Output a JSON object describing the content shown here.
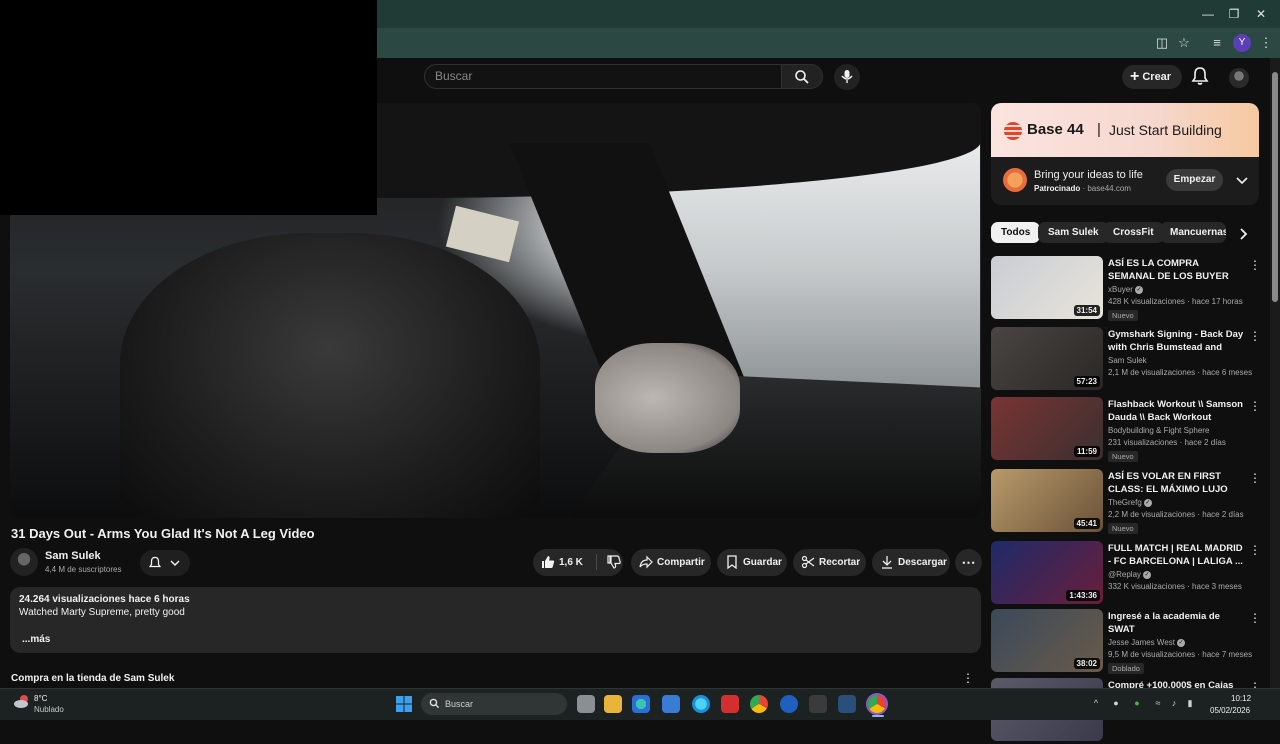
{
  "youtube": {
    "search_placeholder": "Buscar",
    "create_label": "Crear"
  },
  "video": {
    "title": "31 Days Out - Arms You Glad It's Not A Leg Video",
    "channel_name": "Sam Sulek",
    "subscribers": "4,4 M de suscriptores",
    "likes": "1,6 K",
    "actions": {
      "share": "Compartir",
      "save": "Guardar",
      "clip": "Recortar",
      "download": "Descargar"
    },
    "description": {
      "meta": "24.264 visualizaciones  hace 6 horas",
      "text": "Watched Marty Supreme, pretty good",
      "more": "...más"
    },
    "store_title": "Compra en la tienda de Sam Sulek"
  },
  "ad": {
    "brand": "Base 44",
    "divider": "|",
    "tagline": "Just Start Building",
    "headline": "Bring your ideas to life",
    "sponsored_label": "Patrocinado",
    "domain": "base44.com",
    "cta": "Empezar"
  },
  "chips": [
    "Todos",
    "Sam Sulek",
    "CrossFit",
    "Mancuernas"
  ],
  "related": [
    {
      "title": "ASÍ ES LA COMPRA SEMANAL DE LOS BUYER",
      "channel": "xBuyer",
      "verified": true,
      "stats": "428 K visualizaciones · hace 17 horas",
      "badge": "Nuevo",
      "duration": "31:54",
      "thumb_colors": [
        "#c9cdd4",
        "#e8e4da"
      ]
    },
    {
      "title": "Gymshark Signing - Back Day with Chris Bumstead and Davi...",
      "channel": "Sam Sulek",
      "verified": false,
      "stats": "2,1 M de visualizaciones · hace 6 meses",
      "badge": "",
      "duration": "57:23",
      "thumb_colors": [
        "#4a4542",
        "#2a2725"
      ]
    },
    {
      "title": "Flashback Workout \\\\ Samson Dauda \\\\ Back  Workout",
      "channel": "Bodybuilding & Fight Sphere",
      "verified": false,
      "stats": "231 visualizaciones · hace 2 días",
      "badge": "Nuevo",
      "duration": "11:59",
      "thumb_colors": [
        "#7a3434",
        "#3a2f2f"
      ]
    },
    {
      "title": "ASÍ ES VOLAR EN FIRST CLASS: EL MÁXIMO LUJO",
      "channel": "TheGrefg",
      "verified": true,
      "stats": "2,2 M de visualizaciones · hace 2 días",
      "badge": "Nuevo",
      "duration": "45:41",
      "thumb_colors": [
        "#b89a6a",
        "#6a5238"
      ]
    },
    {
      "title": "FULL MATCH | REAL MADRID - FC BARCELONA | LALIGA ...",
      "channel": "@Replay",
      "verified": true,
      "stats": "332 K visualizaciones · hace 3 meses",
      "badge": "",
      "duration": "1:43:36",
      "thumb_colors": [
        "#1e2a6a",
        "#6a1e3a"
      ]
    },
    {
      "title": "Ingresé a la academia de SWAT",
      "channel": "Jesse James West",
      "verified": true,
      "stats": "9,5 M de visualizaciones · hace 7 meses",
      "badge": "Doblado",
      "duration": "38:02",
      "thumb_colors": [
        "#3a4a5a",
        "#6a5a4a"
      ]
    },
    {
      "title": "Compré +100.000$ en Cajas",
      "channel": "",
      "verified": false,
      "stats": "",
      "badge": "",
      "duration": "",
      "thumb_colors": [
        "#5a5a6a",
        "#3a3a4a"
      ]
    }
  ],
  "taskbar": {
    "weather_temp": "8°C",
    "weather_desc": "Nublado",
    "search_label": "Buscar",
    "time": "10:12",
    "date": "05/02/2026"
  },
  "browser": {
    "profile_initial": "Y"
  },
  "colors": {
    "browser_frame": "#203a36",
    "yt_bg": "#0f0f0f",
    "taskbar": "#1c2221"
  }
}
